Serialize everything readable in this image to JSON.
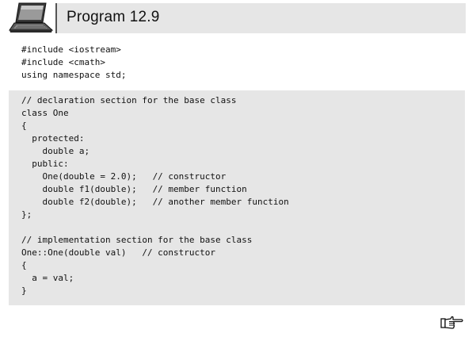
{
  "header": {
    "title": "Program 12.9",
    "icon": "laptop-icon"
  },
  "code": {
    "includes": [
      "#include <iostream>",
      "#include <cmath>",
      "using namespace std;"
    ],
    "body": [
      "// declaration section for the base class",
      "class One",
      "{",
      "  protected:",
      "    double a;",
      "  public:",
      "    One(double = 2.0);   // constructor",
      "    double f1(double);   // member function",
      "    double f2(double);   // another member function",
      "};",
      "",
      "// implementation section for the base class",
      "One::One(double val)   // constructor",
      "{",
      "  a = val;",
      "}"
    ]
  },
  "footer": {
    "icon": "pointing-hand-icon"
  },
  "colors": {
    "panel_background": "#e6e6e6",
    "text": "#111111"
  }
}
